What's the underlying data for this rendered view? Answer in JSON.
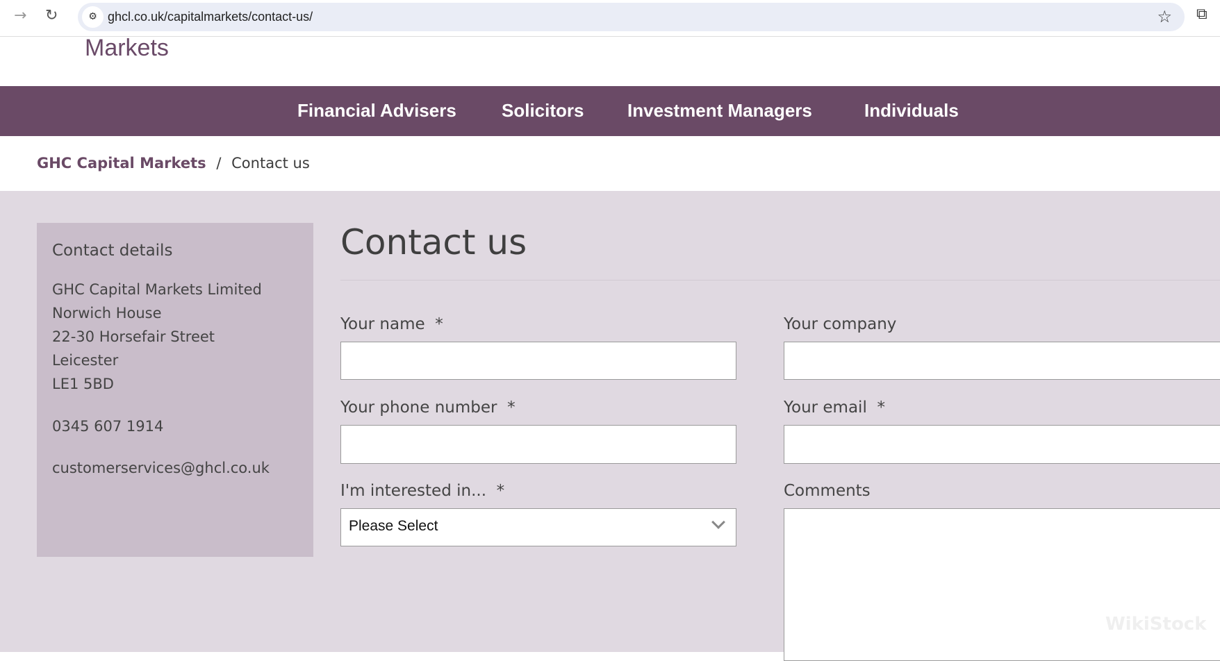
{
  "browser": {
    "url": "ghcl.co.uk/capitalmarkets/contact-us/",
    "icons": [
      "forward-icon",
      "reload-icon",
      "site-settings-icon",
      "star-icon",
      "extensions-icon"
    ]
  },
  "logo": {
    "text": "Markets"
  },
  "nav": {
    "items": [
      "Financial Advisers",
      "Solicitors",
      "Investment Managers",
      "Individuals"
    ]
  },
  "breadcrumb": {
    "home": "GHC Capital Markets",
    "separator": "/",
    "current": "Contact us"
  },
  "sidebar": {
    "title": "Contact details",
    "address": [
      "GHC Capital Markets Limited",
      "Norwich House",
      "22-30 Horsefair Street",
      "Leicester",
      "LE1 5BD"
    ],
    "phone": "0345 607 1914",
    "email": "customerservices@ghcl.co.uk"
  },
  "form": {
    "title": "Contact us",
    "name_label": "Your name",
    "company_label": "Your company",
    "phone_label": "Your phone number",
    "email_label": "Your email",
    "interest_label": "I'm interested in...",
    "comments_label": "Comments",
    "required": "*",
    "interest_value": "Please Select"
  },
  "watermark": "WikiStock",
  "colors": {
    "brand": "#6a4a66",
    "background": "#e0d9e1",
    "sidebar": "#c9bdca"
  }
}
